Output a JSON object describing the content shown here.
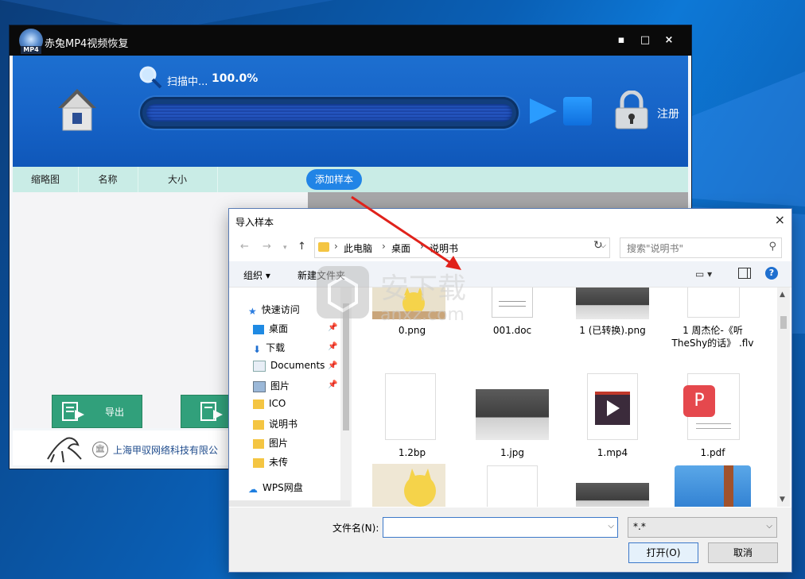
{
  "app": {
    "title": "赤兔MP4视频恢复",
    "logo_text": "MP4",
    "controls": {
      "minimize": "▪",
      "maximize": "□",
      "close": "×"
    },
    "scan_text": "扫描中...",
    "scan_percent": "100.0%",
    "progress_fraction": 1.0,
    "register_label": "注册",
    "columns": [
      "缩略图",
      "名称",
      "大小"
    ],
    "add_sample_label": "添加样本",
    "export_label": "导出",
    "company": "上海甲驭网络科技有限公"
  },
  "dialog": {
    "title": "导入样本",
    "close": "×",
    "breadcrumb": [
      "此电脑",
      "桌面",
      "说明书"
    ],
    "search_placeholder": "搜索\"说明书\"",
    "organize_label": "组织 ▾",
    "new_folder_label": "新建文件夹",
    "nav_items": [
      {
        "label": "快速访问",
        "icon": "star-icon",
        "pinned": false
      },
      {
        "label": "桌面",
        "icon": "desktop-icon",
        "pinned": true
      },
      {
        "label": "下载",
        "icon": "download-icon",
        "pinned": true
      },
      {
        "label": "Documents",
        "icon": "documents-icon",
        "pinned": true
      },
      {
        "label": "图片",
        "icon": "pictures-icon",
        "pinned": true
      },
      {
        "label": "ICO",
        "icon": "folder-icon",
        "pinned": false
      },
      {
        "label": "说明书",
        "icon": "folder-icon",
        "pinned": false
      },
      {
        "label": "图片",
        "icon": "folder-icon",
        "pinned": false
      },
      {
        "label": "未传",
        "icon": "folder-icon",
        "pinned": false
      },
      {
        "label": "WPS网盘",
        "icon": "cloud-icon",
        "pinned": false
      }
    ],
    "files": [
      {
        "name": "0.png",
        "kind": "image-cat"
      },
      {
        "name": "001.doc",
        "kind": "doc"
      },
      {
        "name": "1 (已转换).png",
        "kind": "image-puppies"
      },
      {
        "name": "1 周杰伦-《听 TheShy的话》 .flv",
        "kind": "blank"
      },
      {
        "name": "1.2bp",
        "kind": "blank"
      },
      {
        "name": "1.jpg",
        "kind": "image-puppies"
      },
      {
        "name": "1.mp4",
        "kind": "video"
      },
      {
        "name": "1.pdf",
        "kind": "pdf"
      },
      {
        "name": "",
        "kind": "image-cat"
      },
      {
        "name": "",
        "kind": "blank"
      },
      {
        "name": "",
        "kind": "image-puppies"
      },
      {
        "name": "",
        "kind": "zip"
      }
    ],
    "filename_label": "文件名(N):",
    "filename_value": "",
    "filter_value": "*.*",
    "open_label": "打开(O)",
    "cancel_label": "取消"
  },
  "colors": {
    "app_blue": "#1663c7",
    "header_teal": "#c9ece6",
    "export_green": "#31a07b",
    "arrow_red": "#e0221b"
  }
}
